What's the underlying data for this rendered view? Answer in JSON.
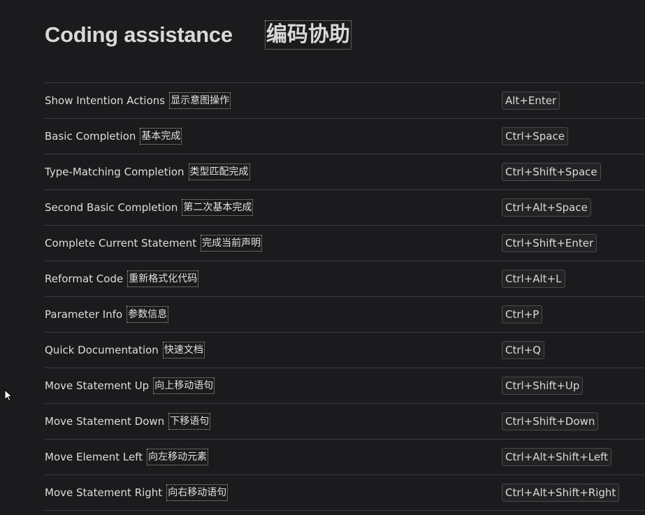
{
  "section": {
    "title": "Coding assistance",
    "title_zh": "编码协助"
  },
  "shortcuts": [
    {
      "label": "Show Intention Actions",
      "label_zh": "显示意图操作",
      "keys": "Alt+Enter"
    },
    {
      "label": "Basic Completion",
      "label_zh": "基本完成",
      "keys": "Ctrl+Space"
    },
    {
      "label": "Type-Matching Completion",
      "label_zh": "类型匹配完成",
      "keys": "Ctrl+Shift+Space"
    },
    {
      "label": "Second Basic Completion",
      "label_zh": "第二次基本完成",
      "keys": "Ctrl+Alt+Space"
    },
    {
      "label": "Complete Current Statement",
      "label_zh": "完成当前声明",
      "keys": "Ctrl+Shift+Enter"
    },
    {
      "label": "Reformat Code",
      "label_zh": "重新格式化代码",
      "keys": "Ctrl+Alt+L"
    },
    {
      "label": "Parameter Info",
      "label_zh": "参数信息",
      "keys": "Ctrl+P"
    },
    {
      "label": "Quick Documentation",
      "label_zh": "快速文档",
      "keys": "Ctrl+Q"
    },
    {
      "label": "Move Statement Up",
      "label_zh": "向上移动语句",
      "keys": "Ctrl+Shift+Up"
    },
    {
      "label": "Move Statement Down",
      "label_zh": "下移语句",
      "keys": "Ctrl+Shift+Down"
    },
    {
      "label": "Move Element Left",
      "label_zh": "向左移动元素",
      "keys": "Ctrl+Alt+Shift+Left"
    },
    {
      "label": "Move Statement Right",
      "label_zh": "向右移动语句",
      "keys": "Ctrl+Alt+Shift+Right"
    }
  ]
}
